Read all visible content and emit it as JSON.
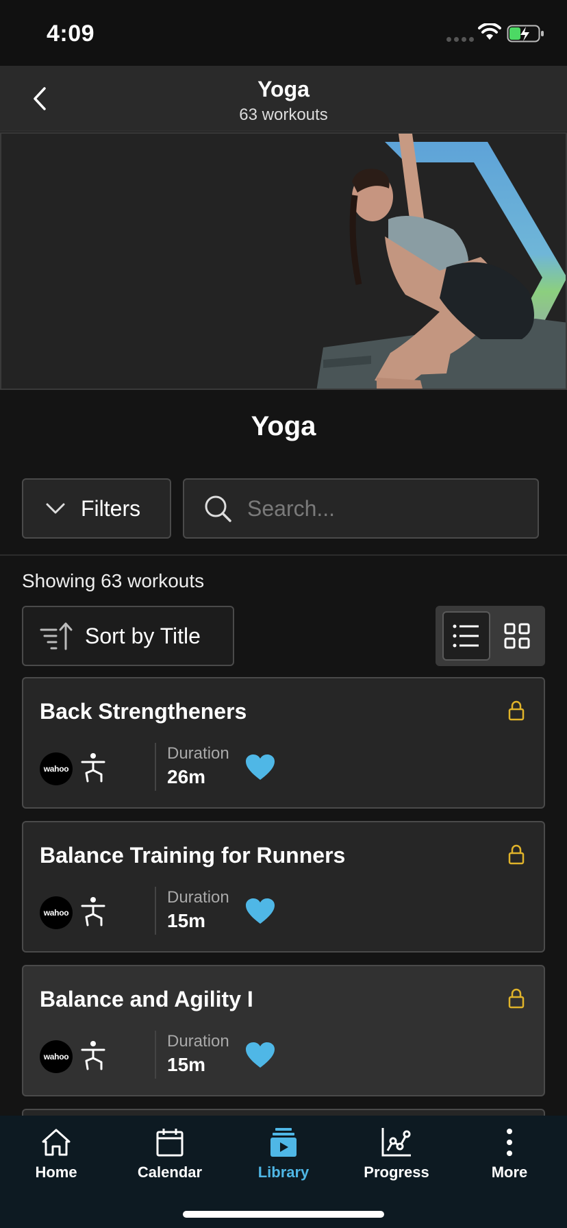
{
  "status_bar": {
    "time": "4:09"
  },
  "header": {
    "title": "Yoga",
    "subtitle": "63 workouts"
  },
  "hero": {
    "image": "woman-yoga-pose",
    "accent_colors": [
      "#5ea3d8",
      "#8ccf7e",
      "#9a86d6"
    ]
  },
  "category_title": "Yoga",
  "filters": {
    "label": "Filters"
  },
  "search": {
    "placeholder": "Search..."
  },
  "results": {
    "showing": "Showing 63 workouts"
  },
  "sort": {
    "label": "Sort by Title"
  },
  "view_toggle": {
    "selected": "list"
  },
  "workouts": [
    {
      "title": "Back Strengtheners",
      "brand": "wahoo",
      "duration_label": "Duration",
      "duration": "26m",
      "favorited": true,
      "locked": true
    },
    {
      "title": "Balance Training for Runners",
      "brand": "wahoo",
      "duration_label": "Duration",
      "duration": "15m",
      "favorited": true,
      "locked": true
    },
    {
      "title": "Balance and Agility I",
      "brand": "wahoo",
      "duration_label": "Duration",
      "duration": "15m",
      "favorited": true,
      "locked": true
    }
  ],
  "tabs": [
    {
      "label": "Home",
      "icon": "home-icon"
    },
    {
      "label": "Calendar",
      "icon": "calendar-icon"
    },
    {
      "label": "Library",
      "icon": "library-icon",
      "active": true
    },
    {
      "label": "Progress",
      "icon": "progress-icon"
    },
    {
      "label": "More",
      "icon": "more-icon"
    }
  ],
  "colors": {
    "accent": "#4fb7e6",
    "lock": "#e0b32a",
    "heart": "#4fb7e6"
  }
}
